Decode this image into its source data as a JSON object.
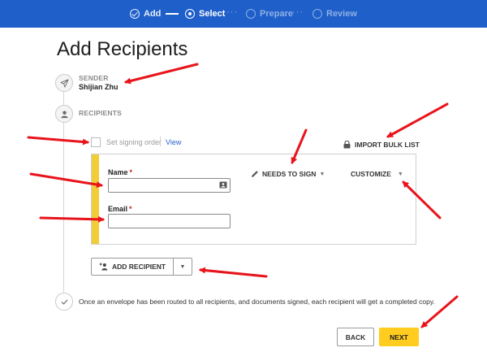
{
  "colors": {
    "brand_blue": "#1f5fc9",
    "accent_yellow": "#ffcc1f",
    "card_accent": "#f2cd3a",
    "link_blue": "#2a62c9",
    "annotation_red": "#e8141b"
  },
  "stepper": {
    "steps": [
      {
        "label": "Add",
        "state": "done",
        "icon": "check-circle-icon"
      },
      {
        "label": "Select",
        "state": "current",
        "icon": "dot-circle-icon"
      },
      {
        "label": "Prepare",
        "state": "future",
        "icon": "empty-circle-icon"
      },
      {
        "label": "Review",
        "state": "future",
        "icon": "empty-circle-icon"
      }
    ]
  },
  "page": {
    "title": "Add Recipients"
  },
  "sender": {
    "label": "SENDER",
    "name": "Shijian Zhu",
    "icon": "paper-plane-icon"
  },
  "recipients": {
    "label": "RECIPIENTS",
    "icon": "person-icon",
    "signing_order_label": "Set signing order",
    "signing_order_checked": false,
    "view_link": "View",
    "import_bulk_label": "IMPORT BULK LIST",
    "import_bulk_icon": "lock-icon"
  },
  "recipient_card": {
    "name_label": "Name",
    "name_value": "",
    "email_label": "Email",
    "email_value": "",
    "required_marker": "*",
    "action_label": "NEEDS TO SIGN",
    "action_icon": "pen-icon",
    "customize_label": "CUSTOMIZE",
    "contact_icon": "contact-card-icon"
  },
  "add_recipient": {
    "label": "ADD RECIPIENT",
    "icon": "add-person-icon"
  },
  "completion": {
    "note": "Once an envelope has been routed to all recipients, and documents signed, each recipient will get a completed copy.",
    "icon": "check-icon"
  },
  "footer": {
    "back_label": "BACK",
    "next_label": "NEXT"
  }
}
